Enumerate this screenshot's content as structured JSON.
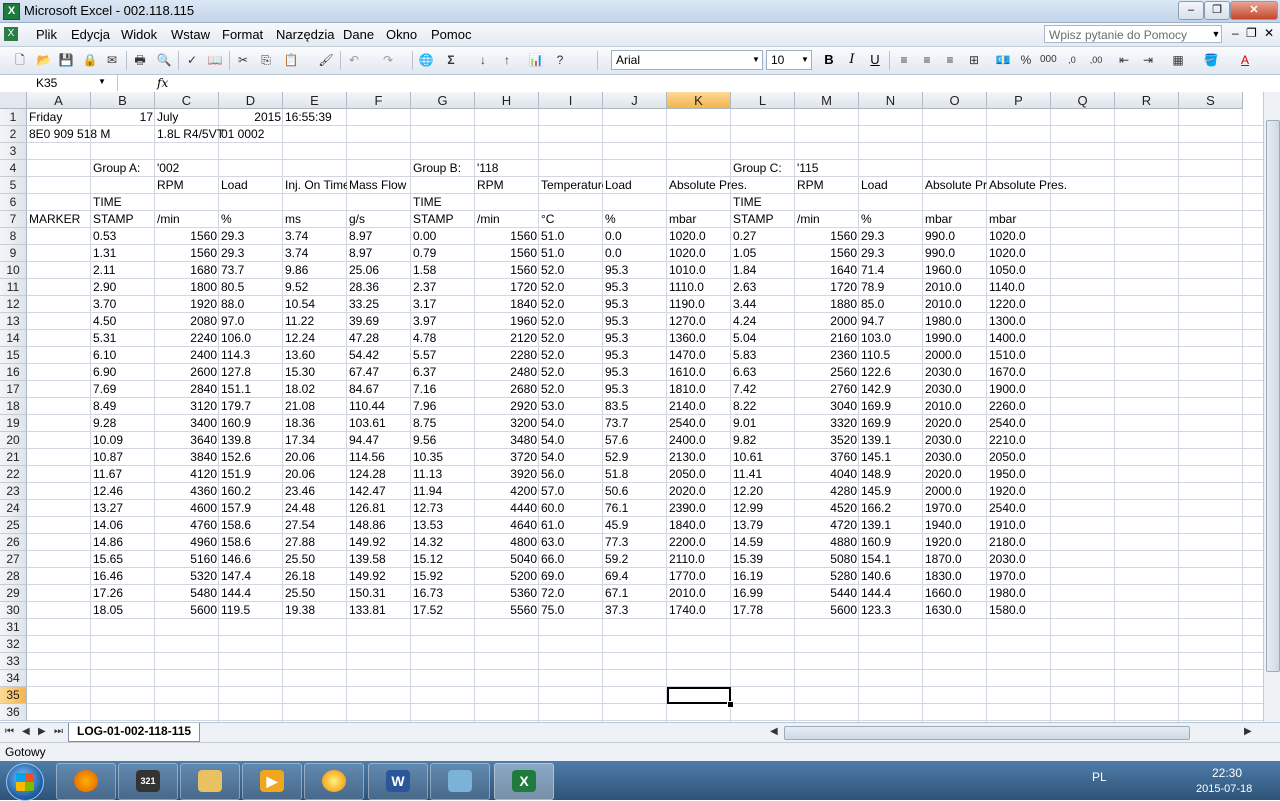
{
  "window": {
    "title": "Microsoft Excel - 002.118.115",
    "minimize": "–",
    "restore": "❐",
    "close": "✕"
  },
  "menubar": {
    "items": [
      "Plik",
      "Edycja",
      "Widok",
      "Wstaw",
      "Format",
      "Narzędzia",
      "Dane",
      "Okno",
      "Pomoc"
    ],
    "help_placeholder": "Wpisz pytanie do Pomocy",
    "win_controls": [
      "–",
      "❐",
      "✕"
    ]
  },
  "toolbar": {
    "font_name": "Arial",
    "font_size": "10",
    "bold": "B",
    "italic": "I",
    "underline": "U"
  },
  "formulabar": {
    "namebox": "K35",
    "fx": "fx"
  },
  "columns": [
    "A",
    "B",
    "C",
    "D",
    "E",
    "F",
    "G",
    "H",
    "I",
    "J",
    "K",
    "L",
    "M",
    "N",
    "O",
    "P",
    "Q",
    "R",
    "S"
  ],
  "selected_column": "K",
  "rows": [
    "1",
    "2",
    "3",
    "4",
    "5",
    "6",
    "7",
    "8",
    "9",
    "10",
    "11",
    "12",
    "13",
    "14",
    "15",
    "16",
    "17",
    "18",
    "19",
    "20",
    "21",
    "22",
    "23",
    "24",
    "25",
    "26",
    "27",
    "28",
    "29",
    "30",
    "31",
    "32",
    "33",
    "34",
    "35",
    "36"
  ],
  "selected_row": "35",
  "header_cells": {
    "a1": "Friday",
    "b1": "17",
    "c1": "July",
    "d1": "2015",
    "e1": "16:55:39",
    "a2": "8E0 909 518 M",
    "c2": "1.8L R4/5VT",
    "d2": "01 0002",
    "b4": "Group A:",
    "c4": "'002",
    "g4": "Group B:",
    "h4": "'118",
    "l4": "Group C:",
    "m4": "'115",
    "c5": "RPM",
    "d5": "Load",
    "e5": "Inj. On Time",
    "f5": "Mass Flow",
    "h5": "RPM",
    "i5": "Temperature",
    "j5": "Load",
    "k5": "Absolute Pres.",
    "m5": "RPM",
    "n5": "Load",
    "o5": "Absolute Pres.",
    "p5": "Absolute Pres.",
    "b6": "TIME",
    "g6": "TIME",
    "l6": "TIME",
    "a7": "MARKER",
    "b7": "STAMP",
    "c7": "/min",
    "d7": "%",
    "e7": "ms",
    "f7": "g/s",
    "g7": "STAMP",
    "h7": "/min",
    "i7": "°C",
    "j7": "%",
    "k7": "mbar",
    "l7": "STAMP",
    "m7": "/min",
    "n7": "%",
    "o7": "mbar",
    "p7": "mbar"
  },
  "data_rows": [
    [
      "0.53",
      "1560",
      "29.3",
      "3.74",
      "8.97",
      "0.00",
      "1560",
      "51.0",
      "0.0",
      "1020.0",
      "0.27",
      "1560",
      "29.3",
      "990.0",
      "1020.0"
    ],
    [
      "1.31",
      "1560",
      "29.3",
      "3.74",
      "8.97",
      "0.79",
      "1560",
      "51.0",
      "0.0",
      "1020.0",
      "1.05",
      "1560",
      "29.3",
      "990.0",
      "1020.0"
    ],
    [
      "2.11",
      "1680",
      "73.7",
      "9.86",
      "25.06",
      "1.58",
      "1560",
      "52.0",
      "95.3",
      "1010.0",
      "1.84",
      "1640",
      "71.4",
      "1960.0",
      "1050.0"
    ],
    [
      "2.90",
      "1800",
      "80.5",
      "9.52",
      "28.36",
      "2.37",
      "1720",
      "52.0",
      "95.3",
      "1110.0",
      "2.63",
      "1720",
      "78.9",
      "2010.0",
      "1140.0"
    ],
    [
      "3.70",
      "1920",
      "88.0",
      "10.54",
      "33.25",
      "3.17",
      "1840",
      "52.0",
      "95.3",
      "1190.0",
      "3.44",
      "1880",
      "85.0",
      "2010.0",
      "1220.0"
    ],
    [
      "4.50",
      "2080",
      "97.0",
      "11.22",
      "39.69",
      "3.97",
      "1960",
      "52.0",
      "95.3",
      "1270.0",
      "4.24",
      "2000",
      "94.7",
      "1980.0",
      "1300.0"
    ],
    [
      "5.31",
      "2240",
      "106.0",
      "12.24",
      "47.28",
      "4.78",
      "2120",
      "52.0",
      "95.3",
      "1360.0",
      "5.04",
      "2160",
      "103.0",
      "1990.0",
      "1400.0"
    ],
    [
      "6.10",
      "2400",
      "114.3",
      "13.60",
      "54.42",
      "5.57",
      "2280",
      "52.0",
      "95.3",
      "1470.0",
      "5.83",
      "2360",
      "110.5",
      "2000.0",
      "1510.0"
    ],
    [
      "6.90",
      "2600",
      "127.8",
      "15.30",
      "67.47",
      "6.37",
      "2480",
      "52.0",
      "95.3",
      "1610.0",
      "6.63",
      "2560",
      "122.6",
      "2030.0",
      "1670.0"
    ],
    [
      "7.69",
      "2840",
      "151.1",
      "18.02",
      "84.67",
      "7.16",
      "2680",
      "52.0",
      "95.3",
      "1810.0",
      "7.42",
      "2760",
      "142.9",
      "2030.0",
      "1900.0"
    ],
    [
      "8.49",
      "3120",
      "179.7",
      "21.08",
      "110.44",
      "7.96",
      "2920",
      "53.0",
      "83.5",
      "2140.0",
      "8.22",
      "3040",
      "169.9",
      "2010.0",
      "2260.0"
    ],
    [
      "9.28",
      "3400",
      "160.9",
      "18.36",
      "103.61",
      "8.75",
      "3200",
      "54.0",
      "73.7",
      "2540.0",
      "9.01",
      "3320",
      "169.9",
      "2020.0",
      "2540.0"
    ],
    [
      "10.09",
      "3640",
      "139.8",
      "17.34",
      "94.47",
      "9.56",
      "3480",
      "54.0",
      "57.6",
      "2400.0",
      "9.82",
      "3520",
      "139.1",
      "2030.0",
      "2210.0"
    ],
    [
      "10.87",
      "3840",
      "152.6",
      "20.06",
      "114.56",
      "10.35",
      "3720",
      "54.0",
      "52.9",
      "2130.0",
      "10.61",
      "3760",
      "145.1",
      "2030.0",
      "2050.0"
    ],
    [
      "11.67",
      "4120",
      "151.9",
      "20.06",
      "124.28",
      "11.13",
      "3920",
      "56.0",
      "51.8",
      "2050.0",
      "11.41",
      "4040",
      "148.9",
      "2020.0",
      "1950.0"
    ],
    [
      "12.46",
      "4360",
      "160.2",
      "23.46",
      "142.47",
      "11.94",
      "4200",
      "57.0",
      "50.6",
      "2020.0",
      "12.20",
      "4280",
      "145.9",
      "2000.0",
      "1920.0"
    ],
    [
      "13.27",
      "4600",
      "157.9",
      "24.48",
      "126.81",
      "12.73",
      "4440",
      "60.0",
      "76.1",
      "2390.0",
      "12.99",
      "4520",
      "166.2",
      "1970.0",
      "2540.0"
    ],
    [
      "14.06",
      "4760",
      "158.6",
      "27.54",
      "148.86",
      "13.53",
      "4640",
      "61.0",
      "45.9",
      "1840.0",
      "13.79",
      "4720",
      "139.1",
      "1940.0",
      "1910.0"
    ],
    [
      "14.86",
      "4960",
      "158.6",
      "27.88",
      "149.92",
      "14.32",
      "4800",
      "63.0",
      "77.3",
      "2200.0",
      "14.59",
      "4880",
      "160.9",
      "1920.0",
      "2180.0"
    ],
    [
      "15.65",
      "5160",
      "146.6",
      "25.50",
      "139.58",
      "15.12",
      "5040",
      "66.0",
      "59.2",
      "2110.0",
      "15.39",
      "5080",
      "154.1",
      "1870.0",
      "2030.0"
    ],
    [
      "16.46",
      "5320",
      "147.4",
      "26.18",
      "149.92",
      "15.92",
      "5200",
      "69.0",
      "69.4",
      "1770.0",
      "16.19",
      "5280",
      "140.6",
      "1830.0",
      "1970.0"
    ],
    [
      "17.26",
      "5480",
      "144.4",
      "25.50",
      "150.31",
      "16.73",
      "5360",
      "72.0",
      "67.1",
      "2010.0",
      "16.99",
      "5440",
      "144.4",
      "1660.0",
      "1980.0"
    ],
    [
      "18.05",
      "5600",
      "119.5",
      "19.38",
      "133.81",
      "17.52",
      "5560",
      "75.0",
      "37.3",
      "1740.0",
      "17.78",
      "5600",
      "123.3",
      "1630.0",
      "1580.0"
    ]
  ],
  "sheet_tab": "LOG-01-002-118-115",
  "status": "Gotowy",
  "tray": {
    "lang": "PL",
    "time": "22:30",
    "date": "2015-07-18"
  },
  "taskbar_apps": [
    "firefox-icon",
    "media-clapper-icon",
    "explorer-icon",
    "media-player-icon",
    "paint-icon",
    "word-icon",
    "app-icon",
    "excel-icon"
  ]
}
